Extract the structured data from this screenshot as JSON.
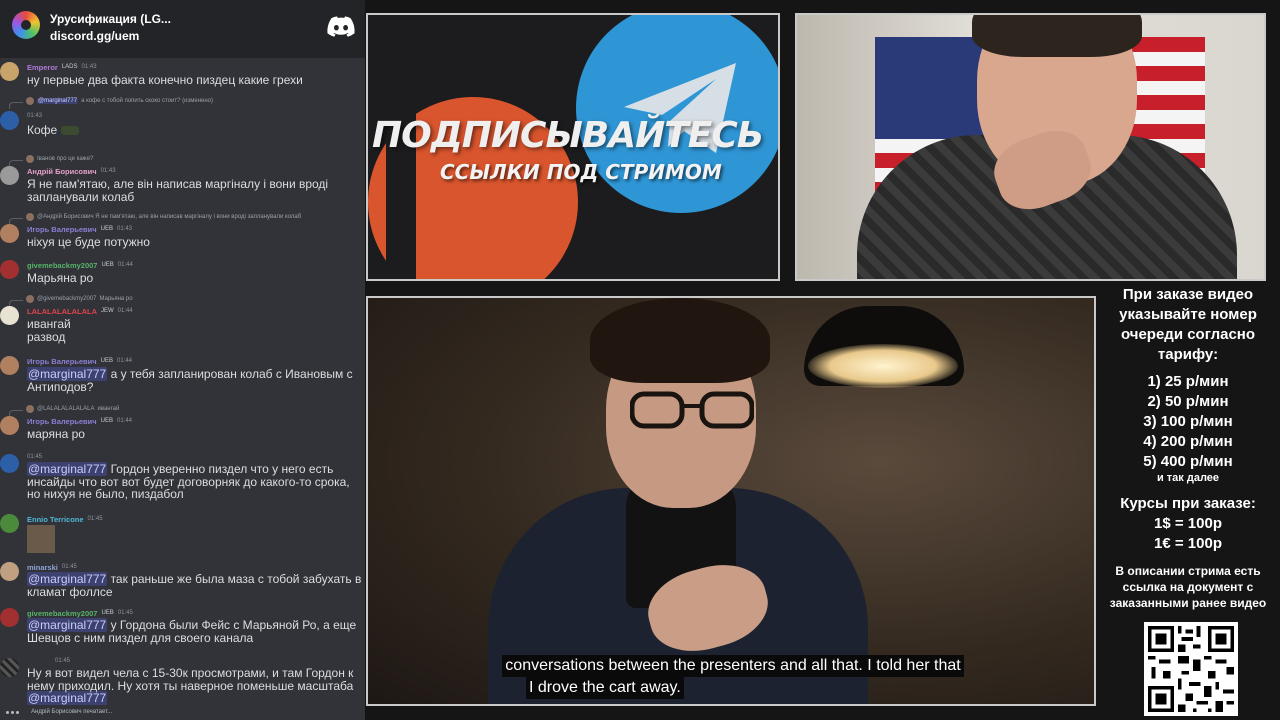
{
  "chat": {
    "server": {
      "name": "Урусификация (LG...",
      "invite": "discord.gg/uem",
      "logo_icon": "discord-icon"
    },
    "messages": [
      {
        "user": "Emperor",
        "tag": "LADS",
        "time": "01:43",
        "text": "ну первые два факта конечно пиздец какие грехи",
        "name_color": "#b07ad6"
      },
      {
        "reply_text": "а кофе с тобой попить скоко стоит? (изменено)",
        "reply_mention": "@marginal777",
        "user": "",
        "tag": "",
        "time": "01:43",
        "text": "Кофе"
      },
      {
        "reply_text": "Іванов про це каже?",
        "user": "Андрій Борисович",
        "time": "01:43",
        "text": "Я не пам'ятаю, але він написав маргіналу і вони вроді запланували колаб",
        "name_color": "#e3a0c8"
      },
      {
        "reply_text": "@Андрій Борисович Я не пам'ятаю, але він написав маргіналу і вони вроді запланували колаб",
        "user": "Игорь Валерьевич",
        "tag": "UEB",
        "time": "01:43",
        "text": "ніхуя це буде потужно",
        "name_color": "#8b7fd6"
      },
      {
        "user": "givemebackmy2007",
        "tag": "UEB",
        "time": "01:44",
        "text": "Марьяна ро",
        "name_color": "#58b368"
      },
      {
        "reply_text": "Марьяна ро",
        "reply_user": "@givemebackmy2007",
        "user": "LALALALALALALA",
        "tag": "JEW",
        "time": "01:44",
        "text": "ивангай\nразвод",
        "name_color": "#e0444e"
      },
      {
        "user": "Игорь Валерьевич",
        "tag": "UEB",
        "time": "01:44",
        "mention": "@marginal777",
        "text": " а у тебя запланирован колаб с Ивановым с Антиподов?",
        "name_color": "#8b7fd6"
      },
      {
        "reply_text": "ивангай",
        "reply_user": "@LALALALALALALA",
        "user": "Игорь Валерьевич",
        "tag": "UEB",
        "time": "01:44",
        "text": "маряна ро",
        "name_color": "#8b7fd6"
      },
      {
        "user": "",
        "time": "01:45",
        "mention": "@marginal777",
        "text": " Гордон уверенно пиздел что у него есть инсайды что вот вот будет договорняк до какого-то срока, но нихуя не было, пиздабол"
      },
      {
        "user": "Ennio Terricone",
        "time": "01:45",
        "text": "",
        "name_color": "#4fb8d8"
      },
      {
        "user": "minarski",
        "time": "01:45",
        "mention": "@marginal777",
        "text": " так раньше же была маза с тобой забухать в кламат фоллсе",
        "name_color": "#8fa3d6"
      },
      {
        "user": "givemebackmy2007",
        "tag": "UEB",
        "time": "01:45",
        "mention": "@marginal777",
        "text": " у Гордона были Фейс с Марьяной Ро, а еще Шевцов с ним пиздел для своего канала",
        "name_color": "#58b368"
      },
      {
        "user": "",
        "time": "01:45",
        "text": "Ну я вот видел чела с 15-30к просмотрами, и там Гордон к нему приходил. Ну хотя ты наверное поменьше масштаба ",
        "trailing_mention": "@marginal777"
      }
    ],
    "typing": "Андрій Борисович печатает..."
  },
  "promo": {
    "title": "ПОДПИСЫВАЙТЕСЬ",
    "subtitle": "ССЫЛКИ ПОД СТРИМОМ",
    "colors": {
      "patreon": "#d9552d",
      "telegram": "#2f96d6"
    }
  },
  "video": {
    "subtitle_line1": "conversations between the presenters and all that. I told her that",
    "subtitle_line2": "I drove the cart away."
  },
  "pricing": {
    "header": "При заказе видео указывайте номер очереди согласно тарифу:",
    "tiers": [
      "1) 25 р/мин",
      "2) 50 р/мин",
      "3) 100 р/мин",
      "4) 200 р/мин",
      "5) 400 р/мин"
    ],
    "etc": "и так далее",
    "rates_header": "Курсы при заказе:",
    "rates": [
      "1$ = 100р",
      "1€ = 100р"
    ],
    "description_note": "В описании стрима есть ссылка на документ с заказанными ранее видео"
  }
}
